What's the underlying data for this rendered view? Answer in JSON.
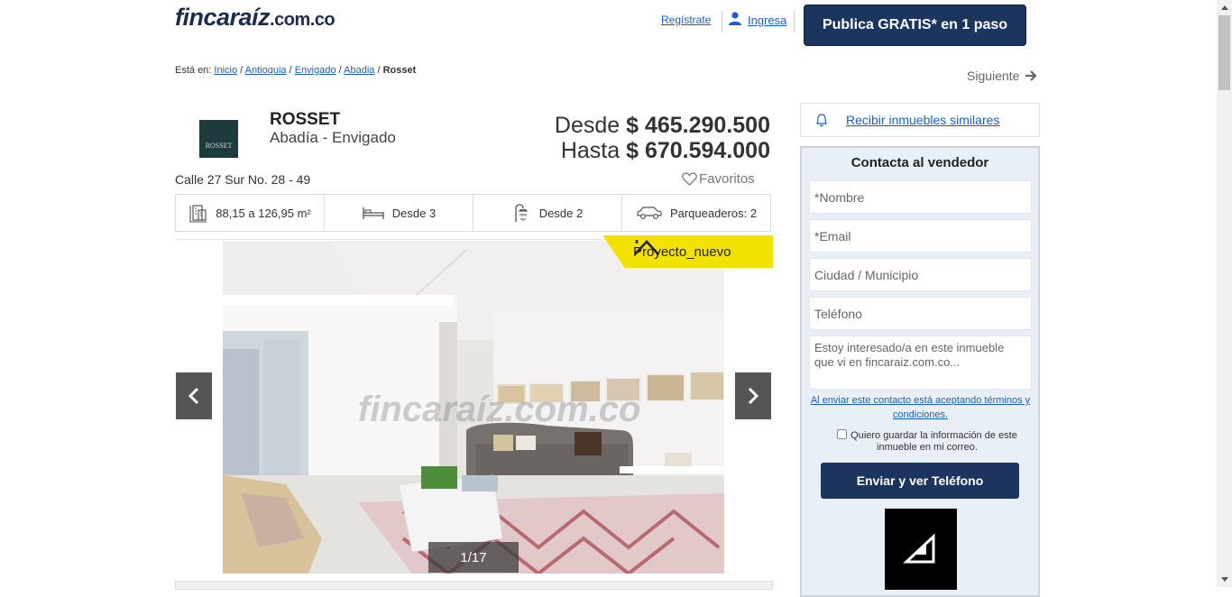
{
  "header": {
    "logo_main": "fincaraíz",
    "logo_dom": ".com.co",
    "register_label": "Regístrate",
    "login_label": "Ingresa",
    "publish_label": "Publica GRATIS* en 1 paso"
  },
  "breadcrumb": {
    "prefix": "Está en:",
    "items": [
      "Inicio",
      "Antioquia",
      "Envigado",
      "Abadia"
    ],
    "current": "Rosset",
    "next_label": "Siguiente"
  },
  "project": {
    "logo_text": "ROSSET",
    "name": "ROSSET",
    "location": "Abadía - Envigado",
    "price_from_label": "Desde",
    "price_from": "$ 465.290.500",
    "price_to_label": "Hasta",
    "price_to": "$ 670.594.000",
    "address": "Calle 27 Sur No. 28 - 49",
    "favorites_label": "Favoritos"
  },
  "features": {
    "area": "88,15 a 126,95 m²",
    "rooms": "Desde  3",
    "baths": "Desde  2",
    "parking": "Parqueaderos: 2"
  },
  "gallery": {
    "badge": "Proyecto_nuevo",
    "counter": "1/17",
    "watermark": "fincaraíz.com.co"
  },
  "sidebar": {
    "similar_label": "Recibir inmuebles similares",
    "contact_title": "Contacta al vendedor",
    "name_placeholder": "*Nombre",
    "email_placeholder": "*Email",
    "city_placeholder": "Ciudad / Municipio",
    "phone_placeholder": "Teléfono",
    "message_placeholder": "Estoy interesado/a en este inmueble que vi en fincaraiz.com.co...",
    "terms_text": "Al enviar este contacto está aceptando términos y condiciones.",
    "save_text": "Quiero guardar la información de este inmueble en mi correo.",
    "send_label": "Enviar y ver Teléfono"
  },
  "colors": {
    "brand_navy": "#1c355e",
    "link_blue": "#1a5fc8",
    "badge_yellow": "#f2e200",
    "logo_red": "#d8232a"
  }
}
